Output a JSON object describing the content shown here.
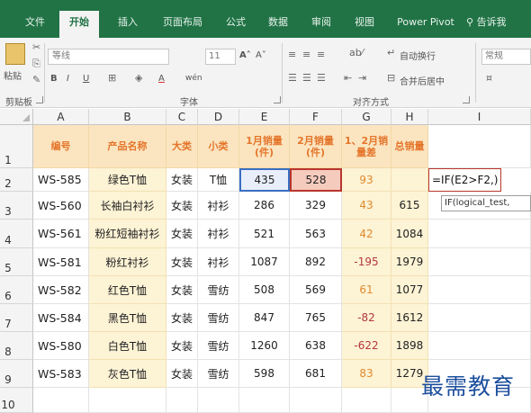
{
  "ribbon_tabs": [
    "文件",
    "开始",
    "插入",
    "页面布局",
    "公式",
    "数据",
    "审阅",
    "视图",
    "Power Pivot"
  ],
  "active_tab": "开始",
  "tell_me": "告诉我",
  "ribbon": {
    "paste_label": "粘贴",
    "font_name": "等线",
    "font_size": "11",
    "bold": "B",
    "italic": "I",
    "underline": "U",
    "grow_font": "A˄",
    "shrink_font": "A˅",
    "font_color": "A",
    "phonetic": "wén",
    "wrap_text": "自动换行",
    "merge_center": "合并后居中",
    "number_format": "常规",
    "group_clipboard": "剪贴板",
    "group_font": "字体",
    "group_alignment": "对齐方式"
  },
  "grid": {
    "column_headers": [
      "A",
      "B",
      "C",
      "D",
      "E",
      "F",
      "G",
      "H",
      "I"
    ],
    "row_numbers": [
      "1",
      "2",
      "3",
      "4",
      "5",
      "6",
      "7",
      "8",
      "9",
      "10"
    ],
    "headers": [
      "编号",
      "产品名称",
      "大类",
      "小类",
      "1月销量(件)",
      "2月销量(件)",
      "1、2月销量差",
      "总销量"
    ],
    "rows": [
      {
        "id": "WS-585",
        "name": "绿色T恤",
        "cat": "女装",
        "sub": "T恤",
        "jan": "435",
        "feb": "528",
        "diff": "93",
        "total": ""
      },
      {
        "id": "WS-560",
        "name": "长袖白衬衫",
        "cat": "女装",
        "sub": "衬衫",
        "jan": "286",
        "feb": "329",
        "diff": "43",
        "total": "615"
      },
      {
        "id": "WS-561",
        "name": "粉红短袖衬衫",
        "cat": "女装",
        "sub": "衬衫",
        "jan": "521",
        "feb": "563",
        "diff": "42",
        "total": "1084"
      },
      {
        "id": "WS-581",
        "name": "粉红衬衫",
        "cat": "女装",
        "sub": "衬衫",
        "jan": "1087",
        "feb": "892",
        "diff": "-195",
        "total": "1979"
      },
      {
        "id": "WS-582",
        "name": "红色T恤",
        "cat": "女装",
        "sub": "雪纺",
        "jan": "508",
        "feb": "569",
        "diff": "61",
        "total": "1077"
      },
      {
        "id": "WS-584",
        "name": "黑色T恤",
        "cat": "女装",
        "sub": "雪纺",
        "jan": "847",
        "feb": "765",
        "diff": "-82",
        "total": "1612"
      },
      {
        "id": "WS-580",
        "name": "白色T恤",
        "cat": "女装",
        "sub": "雪纺",
        "jan": "1260",
        "feb": "638",
        "diff": "-622",
        "total": "1898"
      },
      {
        "id": "WS-583",
        "name": "灰色T恤",
        "cat": "女装",
        "sub": "雪纺",
        "jan": "598",
        "feb": "681",
        "diff": "83",
        "total": "1279"
      }
    ]
  },
  "formula_in_cell": "=IF(E2>F2,)",
  "formula_tooltip": "IF(logical_test,",
  "watermark": "最需教育",
  "colors": {
    "ribbon_green": "#217346",
    "header_fill": "#fbe5c0",
    "header_text": "#e4762c",
    "column_fill": "#fdf3d5",
    "ref_e2_border": "#3a6fc0",
    "ref_f2_border": "#b8362d",
    "negative_text": "#b33939",
    "positive_text": "#e08a2e"
  },
  "icons": [
    "cut-icon",
    "copy-icon",
    "format-painter-icon",
    "border-icon",
    "fill-color-icon",
    "wrap-text-icon",
    "merge-icon",
    "search-icon"
  ]
}
